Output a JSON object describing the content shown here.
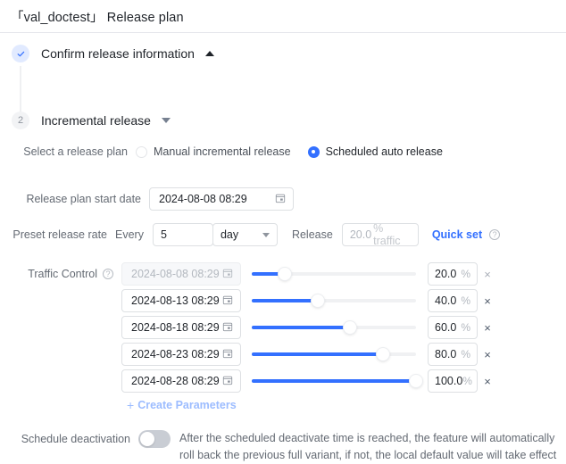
{
  "header": {
    "title": "「val_doctest」 Release plan"
  },
  "steps": [
    {
      "marker": "check",
      "number": "",
      "title": "Confirm release information",
      "caret": "caret-up-icon"
    },
    {
      "marker": "number",
      "number": "2",
      "title": "Incremental release",
      "caret": "caret-down-icon"
    }
  ],
  "release_plan": {
    "label": "Select a release plan",
    "options": [
      {
        "label": "Manual incremental release",
        "selected": false
      },
      {
        "label": "Scheduled auto release",
        "selected": true
      }
    ]
  },
  "start_date": {
    "label": "Release plan start date",
    "value": "2024-08-08 08:29",
    "icon": "calendar-icon"
  },
  "preset_rate": {
    "label": "Preset release rate",
    "every_label": "Every",
    "every_value": "5",
    "unit_value": "day",
    "unit_caret": "chevron-down-icon",
    "release_label": "Release",
    "traffic_value": "20.0",
    "traffic_unit": "% traffic",
    "quick_set": "Quick set",
    "help_icon": "question-circle-icon"
  },
  "traffic_control": {
    "label": "Traffic Control",
    "help_icon": "question-circle-icon",
    "rows": [
      {
        "date": "2024-08-08 08:29",
        "percent": "20.0",
        "unit": "%",
        "value": 20,
        "disabled": true
      },
      {
        "date": "2024-08-13 08:29",
        "percent": "40.0",
        "unit": "%",
        "value": 40,
        "disabled": false
      },
      {
        "date": "2024-08-18 08:29",
        "percent": "60.0",
        "unit": "%",
        "value": 60,
        "disabled": false
      },
      {
        "date": "2024-08-23 08:29",
        "percent": "80.0",
        "unit": "%",
        "value": 80,
        "disabled": false
      },
      {
        "date": "2024-08-28 08:29",
        "percent": "100.0",
        "unit": "%",
        "value": 100,
        "disabled": false
      }
    ],
    "remove_icon": "×",
    "create_parameters": "Create Parameters",
    "create_plus": "+"
  },
  "schedule_deactivation": {
    "label": "Schedule deactivation",
    "enabled": false,
    "description": "After the scheduled deactivate time is reached, the feature will automatically roll back the previous full variant, if not, the local default value will take effect"
  },
  "colors": {
    "accent": "#3370ff",
    "track": "#f0f1f3",
    "border": "#dde0e3",
    "text": "#1f2329",
    "muted": "#646a73"
  }
}
